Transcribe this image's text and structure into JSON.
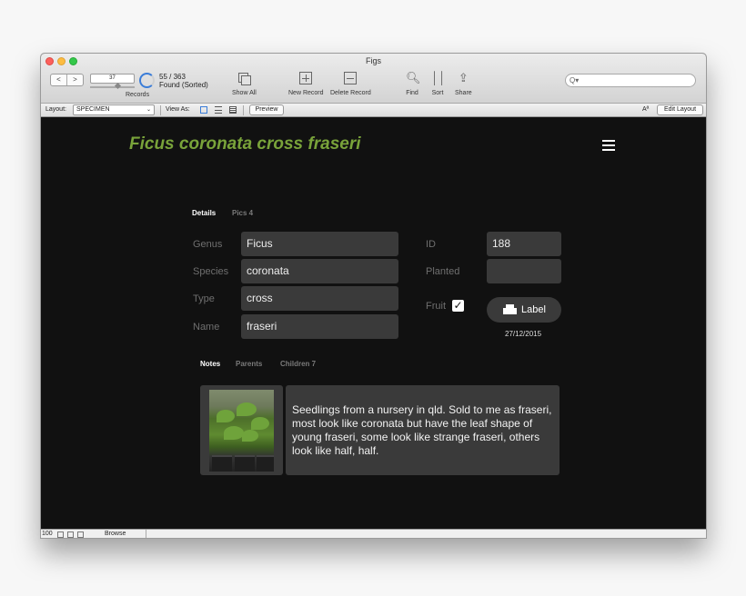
{
  "window": {
    "title": "Figs"
  },
  "toolbar": {
    "back_label": "<",
    "forward_label": ">",
    "record_number": "37",
    "found_count": "55 / 363",
    "found_status": "Found (Sorted)",
    "records_label": "Records",
    "show_all_label": "Show All",
    "new_record_label": "New Record",
    "delete_record_label": "Delete Record",
    "find_label": "Find",
    "sort_label": "Sort",
    "share_label": "Share",
    "search_placeholder": "Q▾"
  },
  "layout_bar": {
    "layout_prefix": "Layout:",
    "layout_value": "SPECIMEN",
    "view_as_label": "View As:",
    "preview_label": "Preview",
    "font_icon_text": "Aª",
    "edit_layout_label": "Edit Layout"
  },
  "record": {
    "title": "Ficus coronata cross fraseri",
    "tabs": {
      "details": "Details",
      "pics": "Pics 4"
    },
    "fields": {
      "genus_label": "Genus",
      "genus_value": "Ficus",
      "species_label": "Species",
      "species_value": "coronata",
      "type_label": "Type",
      "type_value": "cross",
      "name_label": "Name",
      "name_value": "fraseri",
      "id_label": "ID",
      "id_value": "188",
      "planted_label": "Planted",
      "planted_value": "",
      "fruit_label": "Fruit",
      "fruit_checked": "✓"
    },
    "label_button": "Label",
    "date": "27/12/2015",
    "sub_tabs": {
      "notes": "Notes",
      "parents": "Parents",
      "children": "Children 7"
    },
    "notes": "Seedlings from a nursery in qld. Sold to me as fraseri, most look like coronata but have the leaf shape of young fraseri, some look like strange fraseri, others look like half, half."
  },
  "status_bar": {
    "zoom": "100",
    "mode": "Browse"
  },
  "colors": {
    "title_green": "#79a33a",
    "field_bg": "#3a3a3a",
    "content_bg": "#111111"
  }
}
